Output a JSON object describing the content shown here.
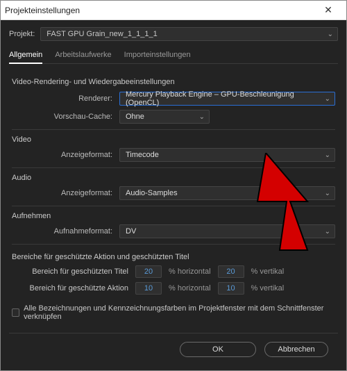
{
  "window": {
    "title": "Projekteinstellungen"
  },
  "project": {
    "label": "Projekt:",
    "value": "FAST GPU Grain_new_1_1_1_1"
  },
  "tabs": {
    "general": "Allgemein",
    "scratch": "Arbeitslaufwerke",
    "import": "Importeinstellungen"
  },
  "sections": {
    "render": {
      "title": "Video-Rendering- und Wiedergabeeinstellungen",
      "renderer_label": "Renderer:",
      "renderer_value": "Mercury Playback Engine – GPU-Beschleunigung (OpenCL)",
      "cache_label": "Vorschau-Cache:",
      "cache_value": "Ohne"
    },
    "video": {
      "heading": "Video",
      "format_label": "Anzeigeformat:",
      "format_value": "Timecode"
    },
    "audio": {
      "heading": "Audio",
      "format_label": "Anzeigeformat:",
      "format_value": "Audio-Samples"
    },
    "capture": {
      "heading": "Aufnehmen",
      "format_label": "Aufnahmeformat:",
      "format_value": "DV"
    },
    "safe": {
      "title": "Bereiche für geschützte Aktion und geschützten Titel",
      "row1_label": "Bereich für geschützten Titel",
      "row1_h": "20",
      "row1_v": "20",
      "row2_label": "Bereich für geschützte Aktion",
      "row2_h": "10",
      "row2_v": "10",
      "unit_h": "% horizontal",
      "unit_v": "% vertikal"
    },
    "link_label": "Alle Bezeichnungen und Kennzeichnungsfarben im Projektfenster mit dem Schnittfenster verknüpfen"
  },
  "footer": {
    "ok": "OK",
    "cancel": "Abbrechen"
  }
}
